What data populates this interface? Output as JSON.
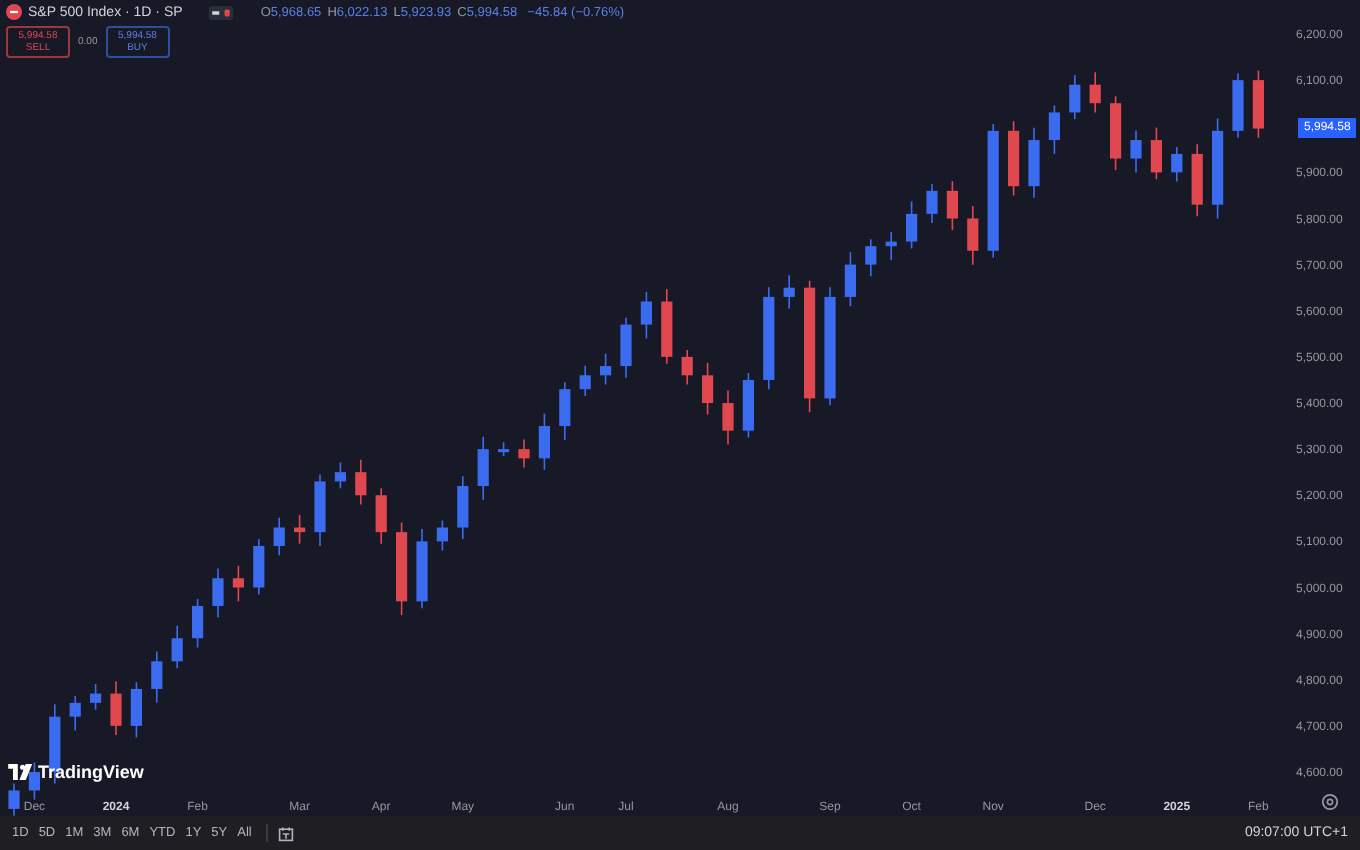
{
  "header": {
    "title": "S&P 500 Index · 1D · SP",
    "ohlc": [
      {
        "label": "O",
        "value": "5,968.65"
      },
      {
        "label": "H",
        "value": "6,022.13"
      },
      {
        "label": "L",
        "value": "5,923.93"
      },
      {
        "label": "C",
        "value": "5,994.58"
      }
    ],
    "change": "−45.84 (−0.76%)"
  },
  "trade": {
    "sell": {
      "price": "5,994.58",
      "label": "SELL"
    },
    "spread": "0.00",
    "buy": {
      "price": "5,994.58",
      "label": "BUY"
    }
  },
  "chart": {
    "price_tag": "5,994.58",
    "chart_data": {
      "type": "candlestick",
      "ylim": [
        4600,
        6200
      ],
      "yticks": [
        {
          "value": 4600,
          "label": "4,600.00"
        },
        {
          "value": 4700,
          "label": "4,700.00"
        },
        {
          "value": 4800,
          "label": "4,800.00"
        },
        {
          "value": 4900,
          "label": "4,900.00"
        },
        {
          "value": 5000,
          "label": "5,000.00"
        },
        {
          "value": 5100,
          "label": "5,100.00"
        },
        {
          "value": 5200,
          "label": "5,200.00"
        },
        {
          "value": 5300,
          "label": "5,300.00"
        },
        {
          "value": 5400,
          "label": "5,400.00"
        },
        {
          "value": 5500,
          "label": "5,500.00"
        },
        {
          "value": 5600,
          "label": "5,600.00"
        },
        {
          "value": 5700,
          "label": "5,700.00"
        },
        {
          "value": 5800,
          "label": "5,800.00"
        },
        {
          "value": 5900,
          "label": "5,900.00"
        },
        {
          "value": 6100,
          "label": "6,100.00"
        },
        {
          "value": 6200,
          "label": "6,200.00"
        }
      ],
      "categories": [
        null,
        "Dec",
        null,
        null,
        null,
        "2024",
        null,
        null,
        null,
        "Feb",
        null,
        null,
        null,
        null,
        "Mar",
        null,
        null,
        null,
        "Apr",
        null,
        null,
        null,
        "May",
        null,
        null,
        null,
        null,
        "Jun",
        null,
        null,
        "Jul",
        null,
        null,
        null,
        null,
        "Aug",
        null,
        null,
        null,
        null,
        "Sep",
        null,
        null,
        null,
        "Oct",
        null,
        null,
        null,
        "Nov",
        null,
        null,
        null,
        null,
        "Dec",
        null,
        null,
        null,
        "2025",
        null,
        null,
        null,
        "Feb"
      ],
      "ohlc": [
        [
          4520,
          4575,
          4505,
          4560
        ],
        [
          4560,
          4621,
          4540,
          4600
        ],
        [
          4600,
          4747,
          4575,
          4720
        ],
        [
          4720,
          4765,
          4690,
          4750
        ],
        [
          4750,
          4791,
          4735,
          4770
        ],
        [
          4770,
          4797,
          4680,
          4700
        ],
        [
          4700,
          4795,
          4675,
          4780
        ],
        [
          4780,
          4861,
          4750,
          4840
        ],
        [
          4840,
          4917,
          4825,
          4890
        ],
        [
          4890,
          4975,
          4870,
          4960
        ],
        [
          4960,
          5041,
          4935,
          5020
        ],
        [
          5020,
          5047,
          4970,
          5000
        ],
        [
          5000,
          5105,
          4985,
          5090
        ],
        [
          5090,
          5151,
          5070,
          5130
        ],
        [
          5130,
          5157,
          5095,
          5120
        ],
        [
          5120,
          5245,
          5090,
          5230
        ],
        [
          5230,
          5271,
          5215,
          5250
        ],
        [
          5250,
          5277,
          5180,
          5200
        ],
        [
          5200,
          5215,
          5095,
          5120
        ],
        [
          5120,
          5141,
          4940,
          4970
        ],
        [
          4970,
          5127,
          4955,
          5100
        ],
        [
          5100,
          5145,
          5080,
          5130
        ],
        [
          5130,
          5241,
          5105,
          5220
        ],
        [
          5220,
          5327,
          5190,
          5300
        ],
        [
          5300,
          5315,
          5285,
          5300
        ],
        [
          5300,
          5321,
          5260,
          5280
        ],
        [
          5280,
          5377,
          5255,
          5350
        ],
        [
          5350,
          5445,
          5320,
          5430
        ],
        [
          5430,
          5481,
          5415,
          5460
        ],
        [
          5460,
          5507,
          5440,
          5480
        ],
        [
          5480,
          5585,
          5455,
          5570
        ],
        [
          5570,
          5641,
          5540,
          5620
        ],
        [
          5620,
          5647,
          5485,
          5500
        ],
        [
          5500,
          5515,
          5440,
          5460
        ],
        [
          5460,
          5487,
          5375,
          5400
        ],
        [
          5400,
          5427,
          5310,
          5340
        ],
        [
          5340,
          5465,
          5325,
          5450
        ],
        [
          5450,
          5651,
          5430,
          5630
        ],
        [
          5630,
          5677,
          5605,
          5650
        ],
        [
          5650,
          5665,
          5380,
          5410
        ],
        [
          5410,
          5651,
          5395,
          5630
        ],
        [
          5630,
          5727,
          5610,
          5700
        ],
        [
          5700,
          5755,
          5675,
          5740
        ],
        [
          5740,
          5771,
          5710,
          5750
        ],
        [
          5750,
          5837,
          5735,
          5810
        ],
        [
          5810,
          5875,
          5790,
          5860
        ],
        [
          5860,
          5881,
          5775,
          5800
        ],
        [
          5800,
          5827,
          5700,
          5730
        ],
        [
          5730,
          6005,
          5715,
          5990
        ],
        [
          5990,
          6011,
          5850,
          5870
        ],
        [
          5870,
          5997,
          5845,
          5970
        ],
        [
          5970,
          6045,
          5940,
          6030
        ],
        [
          6030,
          6111,
          6015,
          6090
        ],
        [
          6090,
          6117,
          6030,
          6050
        ],
        [
          6050,
          6065,
          5905,
          5930
        ],
        [
          5930,
          5991,
          5900,
          5970
        ],
        [
          5970,
          5997,
          5885,
          5900
        ],
        [
          5900,
          5955,
          5880,
          5940
        ],
        [
          5940,
          5961,
          5805,
          5830
        ],
        [
          5830,
          6017,
          5800,
          5990
        ],
        [
          5990,
          6115,
          5975,
          6100
        ],
        [
          6100,
          6121,
          5975,
          5995
        ]
      ]
    }
  },
  "logo": "TradingView",
  "toolbar": {
    "ranges": [
      "1D",
      "5D",
      "1M",
      "3M",
      "6M",
      "YTD",
      "1Y",
      "5Y",
      "All"
    ],
    "time": "09:07:00 UTC+1"
  }
}
